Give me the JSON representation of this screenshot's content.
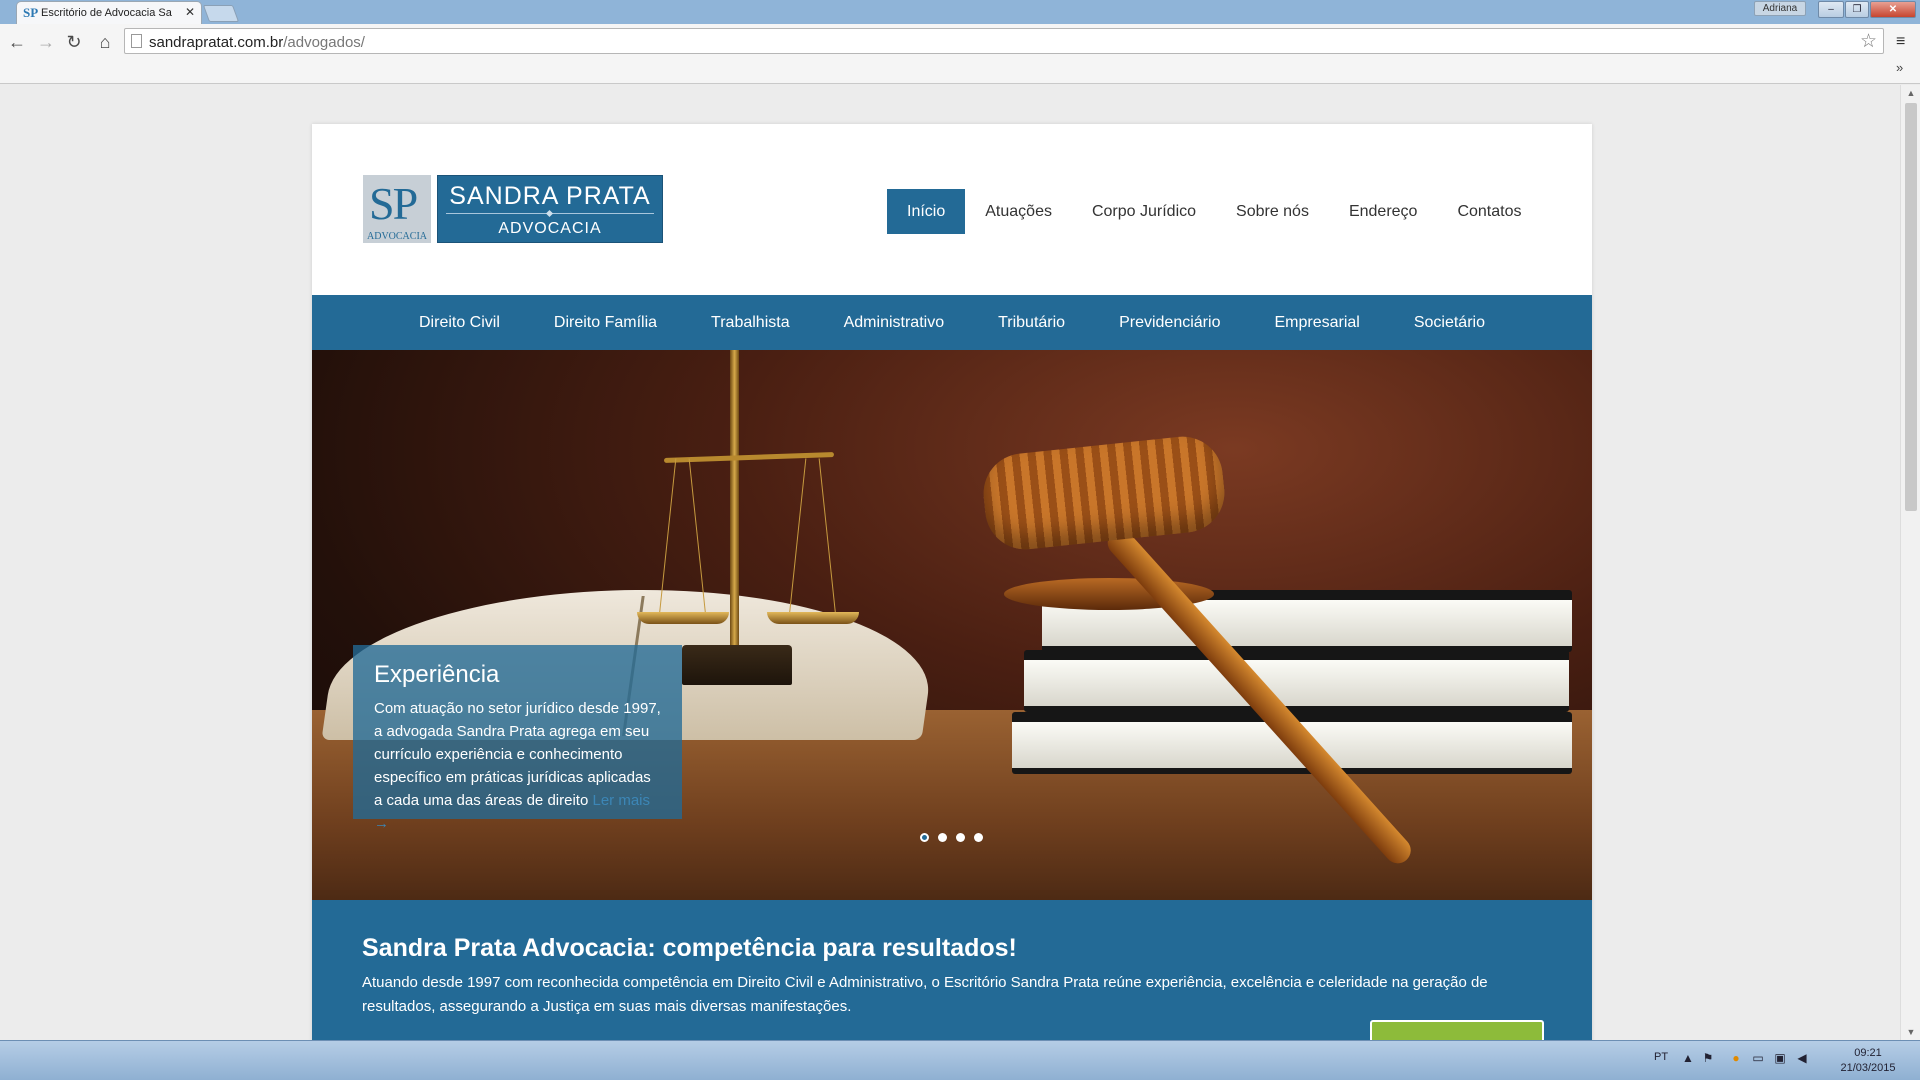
{
  "browser": {
    "tab_title": "Escritório de Advocacia Sa",
    "tab_favicon": "SP",
    "user_badge": "Adriana",
    "url_host": "sandrapratat.com.br",
    "url_path": "/advogados/"
  },
  "site": {
    "logo": {
      "mark": "SP",
      "mark_sub": "ADVOCACIA",
      "name": "SANDRA PRATA",
      "sub": "ADVOCACIA"
    },
    "topnav": [
      {
        "label": "Início",
        "active": true
      },
      {
        "label": "Atuações"
      },
      {
        "label": "Corpo Jurídico"
      },
      {
        "label": "Sobre nós"
      },
      {
        "label": "Endereço"
      },
      {
        "label": "Contatos"
      }
    ],
    "practice_areas": [
      "Direito Civil",
      "Direito Família",
      "Trabalhista",
      "Administrativo",
      "Tributário",
      "Previdenciário",
      "Empresarial",
      "Societário"
    ],
    "slide": {
      "title": "Experiência",
      "text": "Com atuação no setor jurídico desde 1997, a advogada Sandra Prata agrega em seu currículo experiência e conhecimento específico em práticas jurídicas aplicadas a cada uma das áreas de direito",
      "more": "Ler mais →",
      "dots_total": 4,
      "active_dot": 1
    },
    "intro": {
      "title": "Sandra Prata Advocacia: competência para resultados!",
      "text": "Atuando desde 1997 com reconhecida competência em Direito Civil e Administrativo, o Escritório Sandra Prata reúne experiência, excelência e celeridade na geração de resultados, assegurando a Justiça em suas mais diversas manifestações."
    },
    "colors": {
      "brand_blue": "#236a96",
      "cta_green": "#8dbb3a"
    }
  },
  "taskbar": {
    "lang": "PT",
    "time": "09:21",
    "date": "21/03/2015"
  }
}
